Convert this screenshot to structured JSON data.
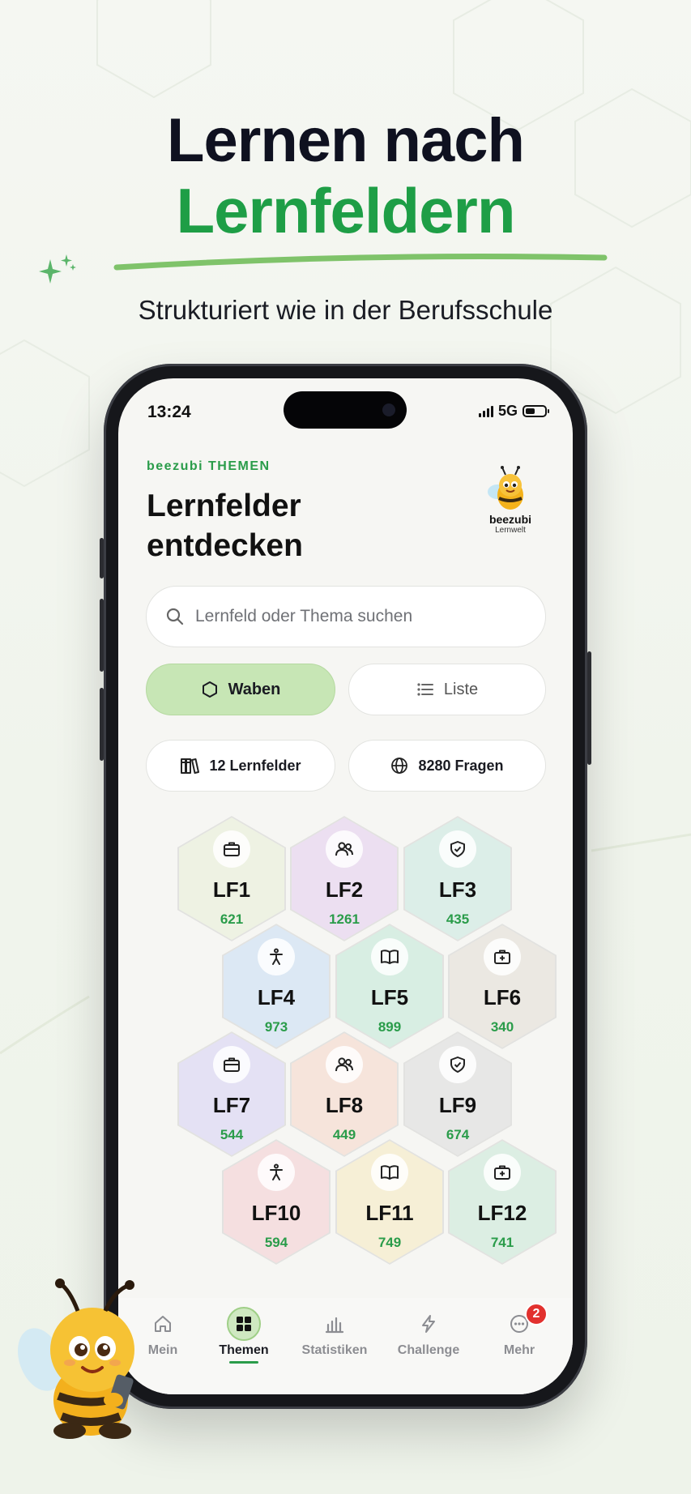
{
  "hero": {
    "title_line1": "Lernen nach",
    "title_line2": "Lernfeldern",
    "subtitle": "Strukturiert wie in der Berufsschule"
  },
  "status_bar": {
    "time": "13:24",
    "network": "5G"
  },
  "header": {
    "eyebrow": "beezubi THEMEN",
    "title": "Lernfelder entdecken",
    "logo_name": "beezubi",
    "logo_sub": "Lernwelt"
  },
  "search": {
    "placeholder": "Lernfeld oder Thema suchen",
    "value": ""
  },
  "view_toggle": {
    "hex_label": "Waben",
    "list_label": "Liste",
    "active": "Waben"
  },
  "stats": {
    "fields_label": "12 Lernfelder",
    "questions_label": "8280 Fragen"
  },
  "colors": {
    "accent": "#2a9c4a",
    "hero_green": "#1e9e46",
    "toggle_active": "#c7e6b5",
    "badge": "#e2312e"
  },
  "fields": [
    {
      "label": "LF1",
      "count": "621",
      "icon": "briefcase-icon",
      "color": "#eef2e3"
    },
    {
      "label": "LF2",
      "count": "1261",
      "icon": "users-icon",
      "color": "#ecdff1"
    },
    {
      "label": "LF3",
      "count": "435",
      "icon": "shield-icon",
      "color": "#dceee8"
    },
    {
      "label": "LF4",
      "count": "973",
      "icon": "person-icon",
      "color": "#dce8f4"
    },
    {
      "label": "LF5",
      "count": "899",
      "icon": "book-icon",
      "color": "#d8eee3"
    },
    {
      "label": "LF6",
      "count": "340",
      "icon": "medkit-icon",
      "color": "#ebe8e2"
    },
    {
      "label": "LF7",
      "count": "544",
      "icon": "briefcase-icon",
      "color": "#e4e1f4"
    },
    {
      "label": "LF8",
      "count": "449",
      "icon": "users-icon",
      "color": "#f6e4db"
    },
    {
      "label": "LF9",
      "count": "674",
      "icon": "shield-icon",
      "color": "#e7e7e6"
    },
    {
      "label": "LF10",
      "count": "594",
      "icon": "person-icon",
      "color": "#f5dfe0"
    },
    {
      "label": "LF11",
      "count": "749",
      "icon": "book-icon",
      "color": "#f6efd6"
    },
    {
      "label": "LF12",
      "count": "741",
      "icon": "medkit-icon",
      "color": "#dceee3"
    }
  ],
  "nav": {
    "items": [
      {
        "label": "Mein"
      },
      {
        "label": "Themen"
      },
      {
        "label": "Statistiken"
      },
      {
        "label": "Challenge"
      },
      {
        "label": "Mehr"
      }
    ],
    "active": "Themen",
    "more_badge": "2"
  }
}
